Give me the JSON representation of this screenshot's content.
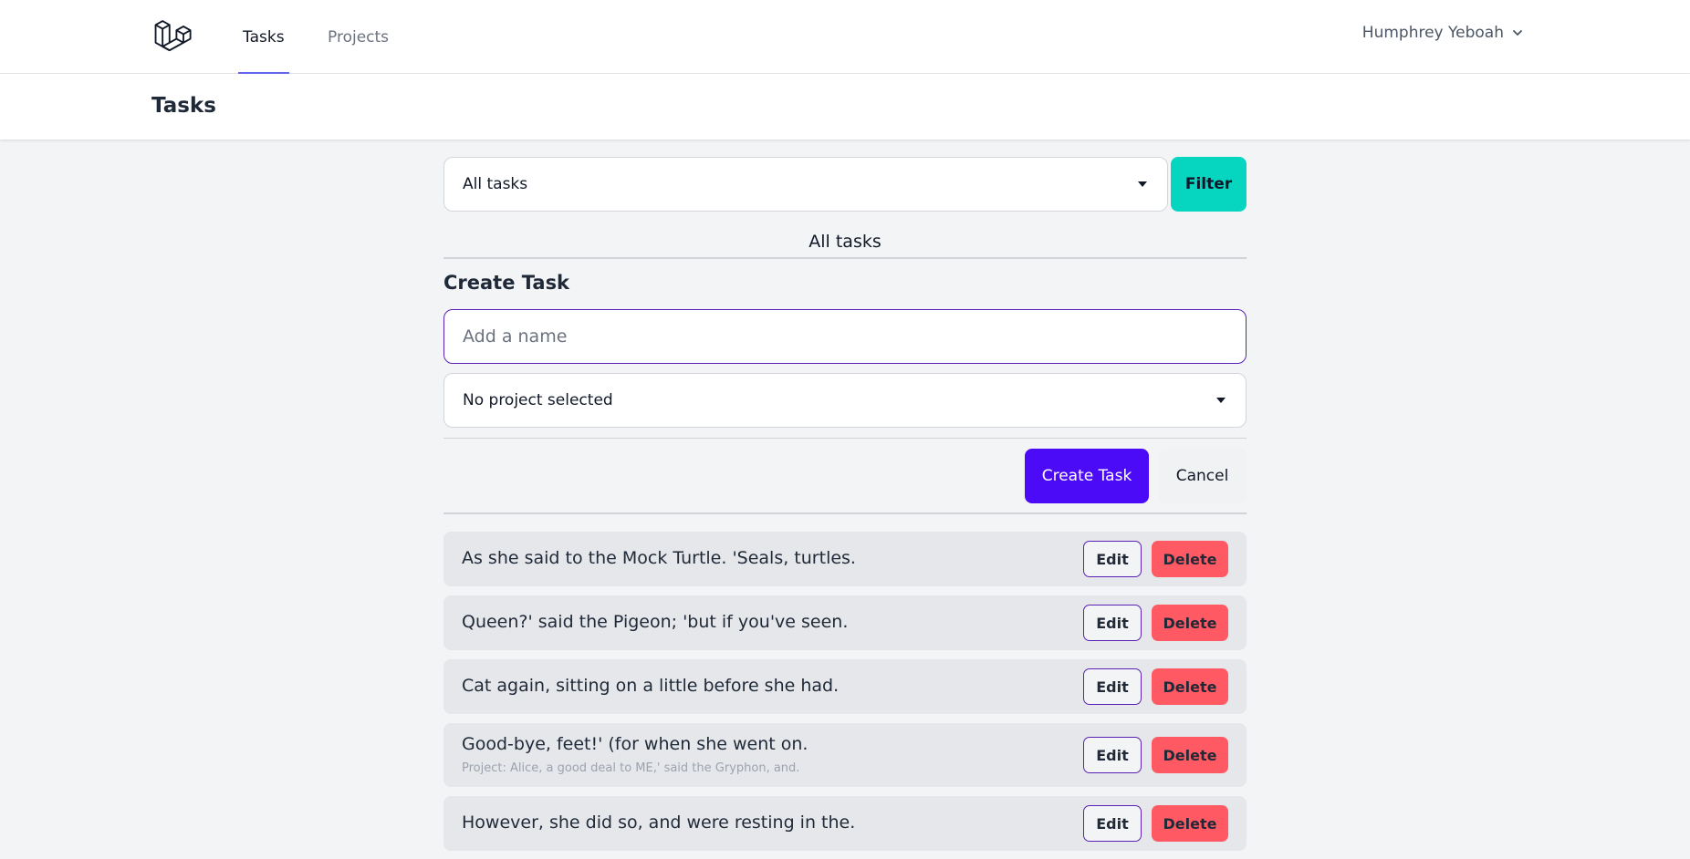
{
  "nav": {
    "links": [
      {
        "label": "Tasks",
        "active": true
      },
      {
        "label": "Projects",
        "active": false
      }
    ],
    "user_name": "Humphrey Yeboah"
  },
  "header": {
    "title": "Tasks"
  },
  "filter": {
    "selected": "All tasks",
    "button_label": "Filter"
  },
  "list_caption": "All tasks",
  "create": {
    "title": "Create Task",
    "name_placeholder": "Add a name",
    "project_selected": "No project selected",
    "submit_label": "Create Task",
    "cancel_label": "Cancel"
  },
  "tasks": [
    {
      "name": "As she said to the Mock Turtle. 'Seals, turtles.",
      "project": "",
      "edit_label": "Edit",
      "delete_label": "Delete"
    },
    {
      "name": "Queen?' said the Pigeon; 'but if you've seen.",
      "project": "",
      "edit_label": "Edit",
      "delete_label": "Delete"
    },
    {
      "name": "Cat again, sitting on a little before she had.",
      "project": "",
      "edit_label": "Edit",
      "delete_label": "Delete"
    },
    {
      "name": "Good-bye, feet!' (for when she went on.",
      "project": "Project: Alice, a good deal to ME,' said the Gryphon, and.",
      "edit_label": "Edit",
      "delete_label": "Delete"
    },
    {
      "name": "However, she did so, and were resting in the.",
      "project": "",
      "edit_label": "Edit",
      "delete_label": "Delete"
    }
  ],
  "colors": {
    "accent": "#4c0bf7",
    "filter": "#06d6bf",
    "danger": "#ff5a63",
    "nav_underline": "#6366f1"
  }
}
